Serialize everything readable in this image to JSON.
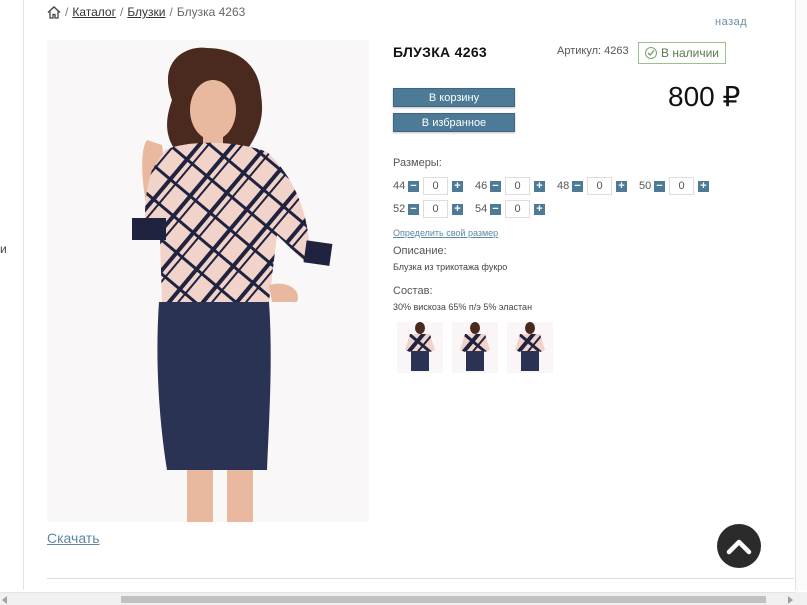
{
  "left_edge": {
    "stub_text": "и"
  },
  "breadcrumb": {
    "items": [
      "Каталог",
      "Блузки"
    ],
    "separator": "/",
    "current": "Блузка 4263"
  },
  "back_link": "назад",
  "product": {
    "title": "БЛУЗКА 4263",
    "sku": "Артикул: 4263",
    "stock": "В наличии",
    "price": "800 ₽",
    "buttons": {
      "cart": "В корзину",
      "favorites": "В избранное"
    },
    "sizes_label": "Размеры:",
    "sizes": [
      {
        "size": "44",
        "qty": "0"
      },
      {
        "size": "46",
        "qty": "0"
      },
      {
        "size": "48",
        "qty": "0"
      },
      {
        "size": "50",
        "qty": "0"
      },
      {
        "size": "52",
        "qty": "0"
      },
      {
        "size": "54",
        "qty": "0"
      }
    ],
    "size_link": "Определить свой размер",
    "description_label": "Описание:",
    "description": "Блузка из трикотажа фукро",
    "composition_label": "Состав:",
    "composition": "30% вискоза 65% п/э 5% эластан",
    "thumbnails_count": 3
  },
  "download_link": "Скачать",
  "colors": {
    "accent": "#4d7a96",
    "link": "#5e87a3",
    "stock_border": "#9cc08d",
    "skirt": "#2b3355",
    "plaid_bg": "#f2d3c9"
  }
}
